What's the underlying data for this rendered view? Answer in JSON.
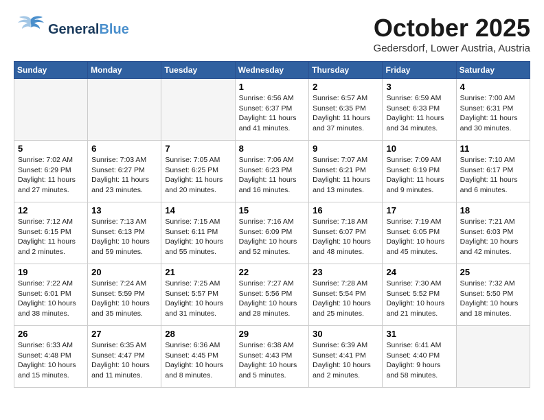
{
  "header": {
    "logo_general": "General",
    "logo_blue": "Blue",
    "month_title": "October 2025",
    "subtitle": "Gedersdorf, Lower Austria, Austria"
  },
  "days_of_week": [
    "Sunday",
    "Monday",
    "Tuesday",
    "Wednesday",
    "Thursday",
    "Friday",
    "Saturday"
  ],
  "weeks": [
    [
      {
        "day": "",
        "info": ""
      },
      {
        "day": "",
        "info": ""
      },
      {
        "day": "",
        "info": ""
      },
      {
        "day": "1",
        "info": "Sunrise: 6:56 AM\nSunset: 6:37 PM\nDaylight: 11 hours\nand 41 minutes."
      },
      {
        "day": "2",
        "info": "Sunrise: 6:57 AM\nSunset: 6:35 PM\nDaylight: 11 hours\nand 37 minutes."
      },
      {
        "day": "3",
        "info": "Sunrise: 6:59 AM\nSunset: 6:33 PM\nDaylight: 11 hours\nand 34 minutes."
      },
      {
        "day": "4",
        "info": "Sunrise: 7:00 AM\nSunset: 6:31 PM\nDaylight: 11 hours\nand 30 minutes."
      }
    ],
    [
      {
        "day": "5",
        "info": "Sunrise: 7:02 AM\nSunset: 6:29 PM\nDaylight: 11 hours\nand 27 minutes."
      },
      {
        "day": "6",
        "info": "Sunrise: 7:03 AM\nSunset: 6:27 PM\nDaylight: 11 hours\nand 23 minutes."
      },
      {
        "day": "7",
        "info": "Sunrise: 7:05 AM\nSunset: 6:25 PM\nDaylight: 11 hours\nand 20 minutes."
      },
      {
        "day": "8",
        "info": "Sunrise: 7:06 AM\nSunset: 6:23 PM\nDaylight: 11 hours\nand 16 minutes."
      },
      {
        "day": "9",
        "info": "Sunrise: 7:07 AM\nSunset: 6:21 PM\nDaylight: 11 hours\nand 13 minutes."
      },
      {
        "day": "10",
        "info": "Sunrise: 7:09 AM\nSunset: 6:19 PM\nDaylight: 11 hours\nand 9 minutes."
      },
      {
        "day": "11",
        "info": "Sunrise: 7:10 AM\nSunset: 6:17 PM\nDaylight: 11 hours\nand 6 minutes."
      }
    ],
    [
      {
        "day": "12",
        "info": "Sunrise: 7:12 AM\nSunset: 6:15 PM\nDaylight: 11 hours\nand 2 minutes."
      },
      {
        "day": "13",
        "info": "Sunrise: 7:13 AM\nSunset: 6:13 PM\nDaylight: 10 hours\nand 59 minutes."
      },
      {
        "day": "14",
        "info": "Sunrise: 7:15 AM\nSunset: 6:11 PM\nDaylight: 10 hours\nand 55 minutes."
      },
      {
        "day": "15",
        "info": "Sunrise: 7:16 AM\nSunset: 6:09 PM\nDaylight: 10 hours\nand 52 minutes."
      },
      {
        "day": "16",
        "info": "Sunrise: 7:18 AM\nSunset: 6:07 PM\nDaylight: 10 hours\nand 48 minutes."
      },
      {
        "day": "17",
        "info": "Sunrise: 7:19 AM\nSunset: 6:05 PM\nDaylight: 10 hours\nand 45 minutes."
      },
      {
        "day": "18",
        "info": "Sunrise: 7:21 AM\nSunset: 6:03 PM\nDaylight: 10 hours\nand 42 minutes."
      }
    ],
    [
      {
        "day": "19",
        "info": "Sunrise: 7:22 AM\nSunset: 6:01 PM\nDaylight: 10 hours\nand 38 minutes."
      },
      {
        "day": "20",
        "info": "Sunrise: 7:24 AM\nSunset: 5:59 PM\nDaylight: 10 hours\nand 35 minutes."
      },
      {
        "day": "21",
        "info": "Sunrise: 7:25 AM\nSunset: 5:57 PM\nDaylight: 10 hours\nand 31 minutes."
      },
      {
        "day": "22",
        "info": "Sunrise: 7:27 AM\nSunset: 5:56 PM\nDaylight: 10 hours\nand 28 minutes."
      },
      {
        "day": "23",
        "info": "Sunrise: 7:28 AM\nSunset: 5:54 PM\nDaylight: 10 hours\nand 25 minutes."
      },
      {
        "day": "24",
        "info": "Sunrise: 7:30 AM\nSunset: 5:52 PM\nDaylight: 10 hours\nand 21 minutes."
      },
      {
        "day": "25",
        "info": "Sunrise: 7:32 AM\nSunset: 5:50 PM\nDaylight: 10 hours\nand 18 minutes."
      }
    ],
    [
      {
        "day": "26",
        "info": "Sunrise: 6:33 AM\nSunset: 4:48 PM\nDaylight: 10 hours\nand 15 minutes."
      },
      {
        "day": "27",
        "info": "Sunrise: 6:35 AM\nSunset: 4:47 PM\nDaylight: 10 hours\nand 11 minutes."
      },
      {
        "day": "28",
        "info": "Sunrise: 6:36 AM\nSunset: 4:45 PM\nDaylight: 10 hours\nand 8 minutes."
      },
      {
        "day": "29",
        "info": "Sunrise: 6:38 AM\nSunset: 4:43 PM\nDaylight: 10 hours\nand 5 minutes."
      },
      {
        "day": "30",
        "info": "Sunrise: 6:39 AM\nSunset: 4:41 PM\nDaylight: 10 hours\nand 2 minutes."
      },
      {
        "day": "31",
        "info": "Sunrise: 6:41 AM\nSunset: 4:40 PM\nDaylight: 9 hours\nand 58 minutes."
      },
      {
        "day": "",
        "info": ""
      }
    ]
  ]
}
